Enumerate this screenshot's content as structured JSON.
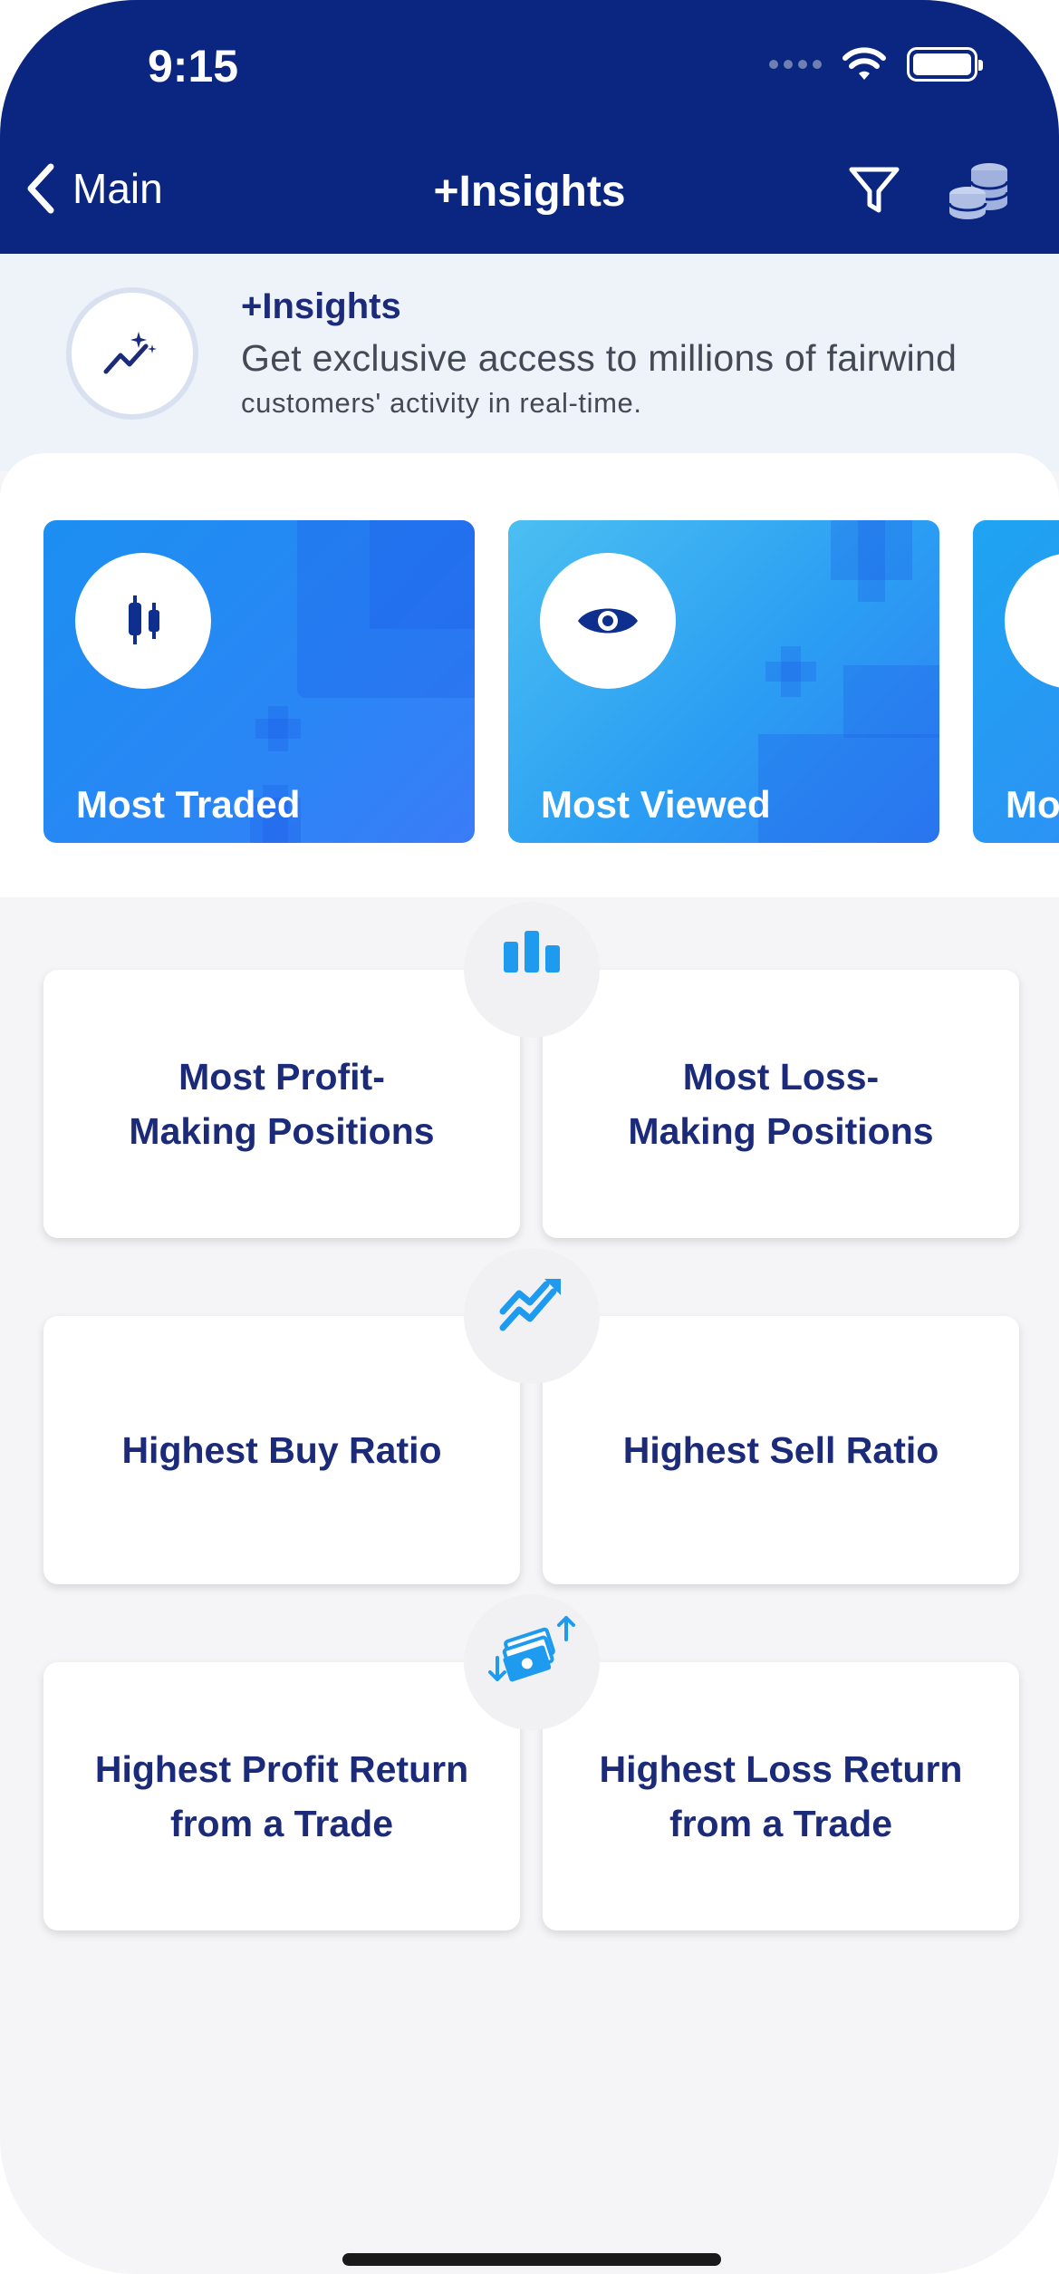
{
  "status_bar": {
    "time": "9:15"
  },
  "nav": {
    "back_label": "Main",
    "title": "+Insights",
    "icons": [
      "chevron-left-icon",
      "filter-icon",
      "coins-icon"
    ]
  },
  "intro": {
    "title": "+Insights",
    "line1": "Get exclusive access to millions of fairwind",
    "line2": "customers' activity in real-time.",
    "icon": "sparkle-trend-icon"
  },
  "carousel": [
    {
      "label": "Most Traded",
      "icon": "candlestick-icon"
    },
    {
      "label": "Most Viewed",
      "icon": "eye-icon"
    },
    {
      "label": "Mo",
      "icon": "card-icon"
    }
  ],
  "grid": {
    "rows": [
      {
        "icon": "bar-chart-icon",
        "left": "Most Profit-\nMaking Positions",
        "right": "Most Loss-\nMaking Positions"
      },
      {
        "icon": "trend-arrow-icon",
        "left": "Highest Buy Ratio",
        "right": "Highest Sell Ratio"
      },
      {
        "icon": "money-exchange-icon",
        "left": "Highest Profit Return\nfrom a Trade",
        "right": "Highest  Loss Return\nfrom a Trade"
      }
    ]
  },
  "colors": {
    "header": "#0a2680",
    "card_text": "#1b2b7a",
    "accent": "#1e9bef"
  }
}
